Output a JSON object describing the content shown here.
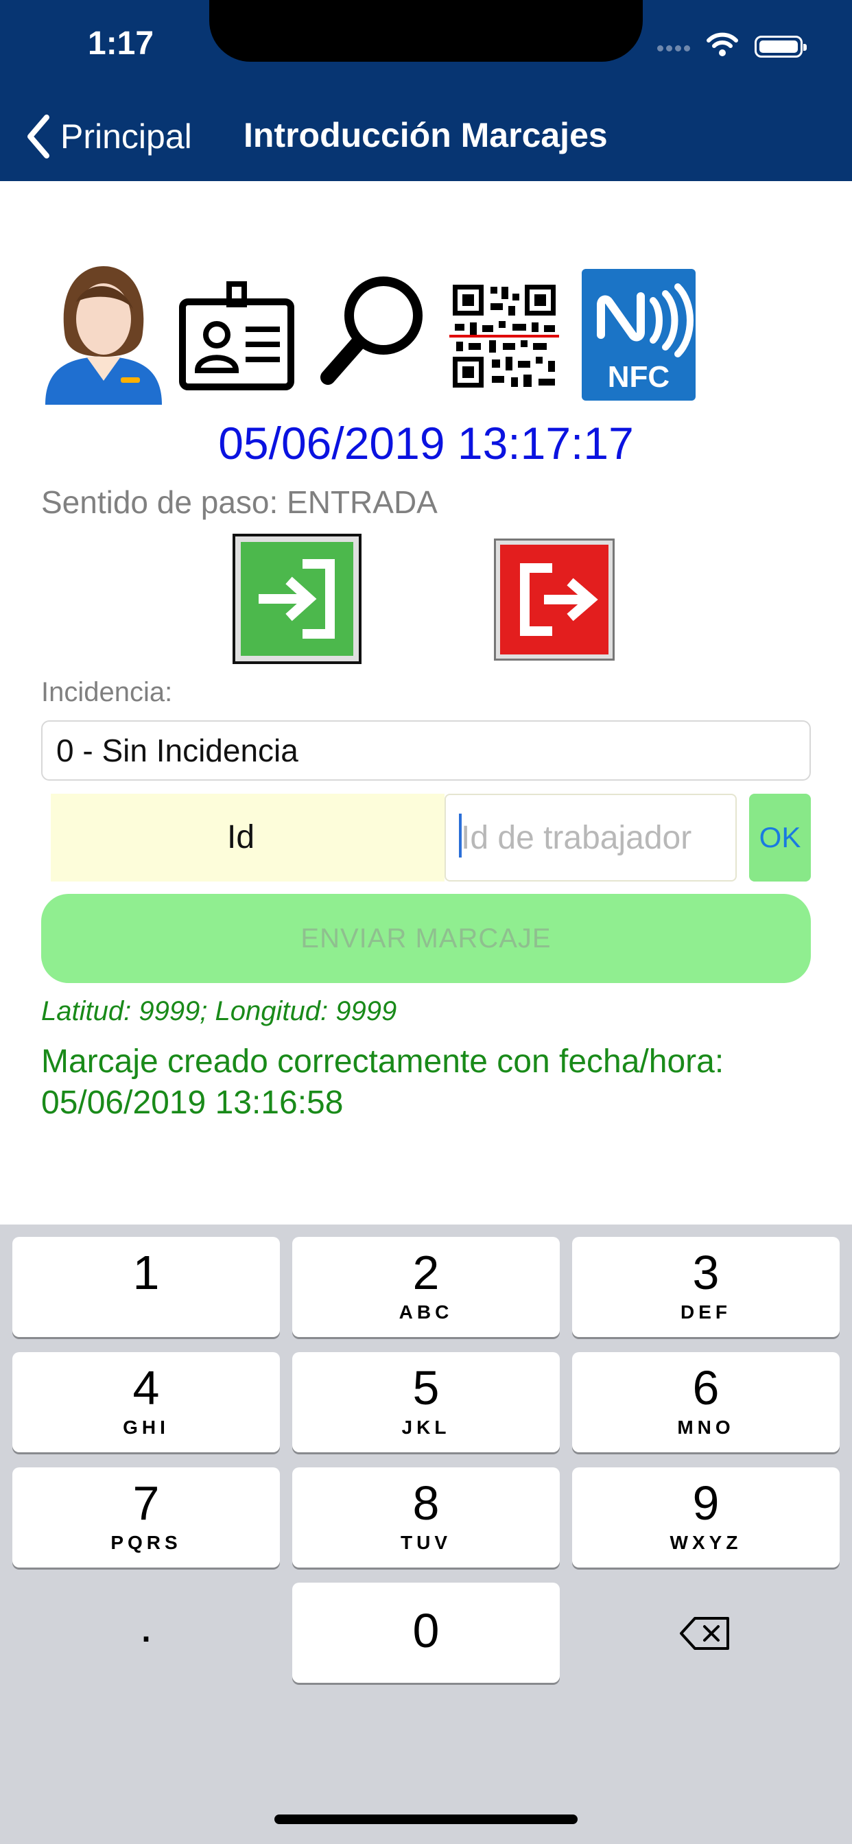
{
  "status_bar": {
    "time": "1:17"
  },
  "nav": {
    "back_label": "Principal",
    "title": "Introducción Marcajes"
  },
  "icons": [
    "worker-avatar-icon",
    "id-badge-icon",
    "search-icon",
    "qr-code-icon",
    "nfc-icon"
  ],
  "nfc_label": "NFC",
  "datetime": "05/06/2019 13:17:17",
  "direction_text": "Sentido de paso: ENTRADA",
  "incidence": {
    "label": "Incidencia:",
    "value": "0 - Sin Incidencia"
  },
  "worker_id": {
    "label": "Id",
    "placeholder": "Id de trabajador",
    "value": "",
    "ok_label": "OK"
  },
  "send_button": "ENVIAR MARCAJE",
  "coordinates_text": "Latitud: 9999; Longitud: 9999",
  "result_message": "Marcaje creado correctamente con fecha/hora: 05/06/2019 13:16:58",
  "colors": {
    "header": "#073572",
    "datetime": "#0a12e0",
    "success": "#198a19",
    "entry_green": "#4cb84c",
    "exit_red": "#e31e1e",
    "send_bg": "#90ee90"
  },
  "keyboard": {
    "rows": [
      [
        {
          "num": "1",
          "letters": ""
        },
        {
          "num": "2",
          "letters": "ABC"
        },
        {
          "num": "3",
          "letters": "DEF"
        }
      ],
      [
        {
          "num": "4",
          "letters": "GHI"
        },
        {
          "num": "5",
          "letters": "JKL"
        },
        {
          "num": "6",
          "letters": "MNO"
        }
      ],
      [
        {
          "num": "7",
          "letters": "PQRS"
        },
        {
          "num": "8",
          "letters": "TUV"
        },
        {
          "num": "9",
          "letters": "WXYZ"
        }
      ]
    ],
    "decimal": ".",
    "zero": "0"
  }
}
